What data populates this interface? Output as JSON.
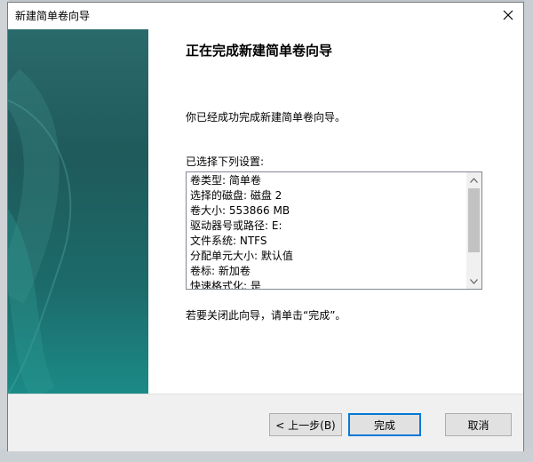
{
  "dialog": {
    "title": "新建简单卷向导",
    "heading": "正在完成新建简单卷向导",
    "completed_message": "你已经成功完成新建简单卷向导。",
    "settings_label": "已选择下列设置:",
    "summary": [
      "卷类型: 简单卷",
      "选择的磁盘: 磁盘 2",
      "卷大小: 553866 MB",
      "驱动器号或路径: E:",
      "文件系统: NTFS",
      "分配单元大小: 默认值",
      "卷标: 新加卷",
      "快速格式化: 是"
    ],
    "close_instruction": "若要关闭此向导，请单击“完成”。"
  },
  "buttons": {
    "back": "< 上一步(B)",
    "finish": "完成",
    "cancel": "取消"
  },
  "icons": {
    "close": "close-icon",
    "scroll_up": "scroll-up-arrow-icon",
    "scroll_down": "scroll-down-arrow-icon"
  },
  "colors": {
    "banner_dark": "#1f5a5b",
    "banner_light": "#1b8a86",
    "focus_border": "#0078d7",
    "footer_bg": "#f0f0f0"
  }
}
